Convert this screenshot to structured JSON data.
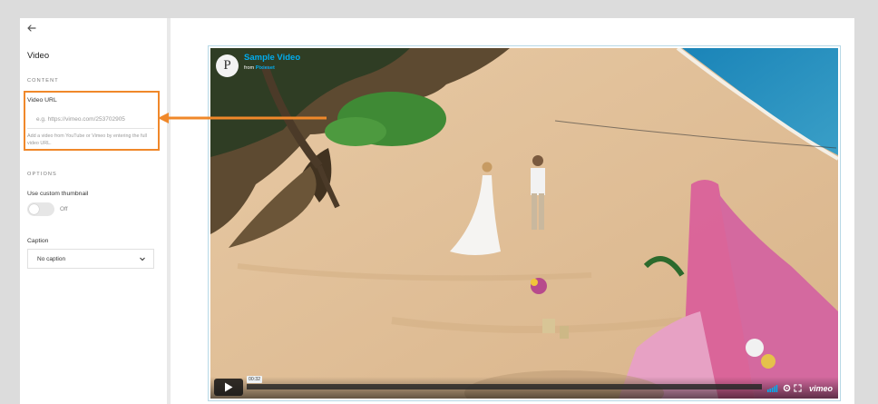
{
  "panel": {
    "title": "Video",
    "content_label": "CONTENT",
    "video_url_label": "Video URL",
    "video_url_placeholder": "e.g. https://vimeo.com/253702905",
    "video_url_value": "",
    "help_text": "Add a video from YouTube or Vimeo by entering the full video URL.",
    "options_label": "OPTIONS",
    "custom_thumbnail_label": "Use custom thumbnail",
    "toggle_state": "Off",
    "caption_label": "Caption",
    "caption_value": "No caption"
  },
  "player": {
    "title": "Sample Video",
    "from_prefix": "from",
    "from_name": "Pixieset",
    "logo_letter": "P",
    "time": "00:32",
    "brand": "vimeo",
    "accent_color": "#00adef"
  },
  "annotation": {
    "color": "#f0882a"
  }
}
